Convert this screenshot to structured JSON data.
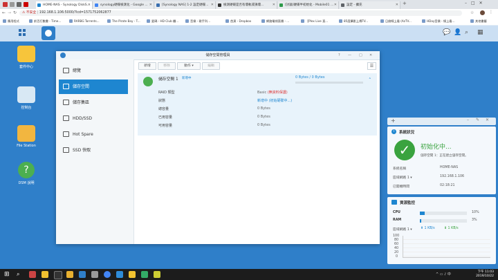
{
  "browser": {
    "tabs": [
      {
        "title": "HOME-NAS - Synology DiskS...",
        "active": true,
        "color": "#1e86d0"
      },
      {
        "title": "synology硬碟檢測化 - Google ...",
        "active": false,
        "color": "#4285f4"
      },
      {
        "title": "[Synology NAS] 1-2 設定硬碟...",
        "active": false,
        "color": "#3a6fb0"
      },
      {
        "title": "檢測硬碟是否有壞軌或損壞...",
        "active": false,
        "color": "#333333"
      },
      {
        "title": "[討論]硬碟半初始化 - Mobile01 ...",
        "active": false,
        "color": "#2e9a4a"
      },
      {
        "title": "設定 - 擴充",
        "active": false,
        "color": "#5f6368"
      }
    ],
    "new_tab": "+",
    "url_insecure": "不安全",
    "url": "192.168.1.106:5000/?lcd=1571752062877",
    "bookmarks": [
      "應用程式",
      "前百打數書 - Time...",
      "RARBG Torrents...",
      "The Pirate Bay - T...",
      "愛碼 - HD Club 櫃...",
      "音樂 - 歌手列... ",
      "首頁 - Dropbox",
      "網路電視直播 - ...",
      "【Plex Live 直...",
      "85度攝影上傳TV...",
      "日劇線上看 (AzTV...",
      "HDay音樂 - 線上看...",
      "其他書籤"
    ]
  },
  "desktop": {
    "icons": [
      {
        "label": "套件中心"
      },
      {
        "label": "控制台"
      },
      {
        "label": "File Station"
      },
      {
        "label": "DSM 說明"
      }
    ]
  },
  "window": {
    "title": "儲存空間管理員",
    "controls": [
      "?",
      "—",
      "□",
      "✕"
    ],
    "sidebar": [
      {
        "label": "總覽",
        "icon": "overview-icon",
        "selected": false
      },
      {
        "label": "儲存空間",
        "icon": "volume-icon",
        "selected": true
      },
      {
        "label": "儲存集區",
        "icon": "storage-pool-icon",
        "selected": false
      },
      {
        "label": "HDD/SSD",
        "icon": "hdd-icon",
        "selected": false
      },
      {
        "label": "Hot Spare",
        "icon": "hot-spare-icon",
        "selected": false
      },
      {
        "label": "SSD 快取",
        "icon": "ssd-cache-icon",
        "selected": false
      }
    ],
    "toolbar": {
      "create": "新增",
      "remove": "移除",
      "action": "動作 ▾",
      "edit": "編輯"
    },
    "volume": {
      "name": "儲存空間 1",
      "status_short": "新增中",
      "capacity": "0 Bytes / 0 Bytes",
      "progress": 0,
      "fields": [
        {
          "label": "RAID 類型",
          "value": "Basic",
          "extra": "(無資料保護)"
        },
        {
          "label": "狀態",
          "value": "新增中 (初始硬碟中...)",
          "extra": ""
        },
        {
          "label": "總容量",
          "value": "0 Bytes",
          "extra": ""
        },
        {
          "label": "已用容量",
          "value": "0 Bytes",
          "extra": ""
        },
        {
          "label": "可用容量",
          "value": "0 Bytes",
          "extra": ""
        }
      ]
    }
  },
  "widgets": {
    "system": {
      "title": "系統狀況",
      "status": "初始化中...",
      "message": "儲存空間 1：正在建立儲存空間。",
      "rows": [
        {
          "label": "系統名稱",
          "value": "HOME-NAS"
        },
        {
          "label": "區域網路 1 ▾",
          "value": "192.168.1.106"
        },
        {
          "label": "已開機時間",
          "value": "02:18:21"
        }
      ]
    },
    "resource": {
      "title": "資源監控",
      "cpu_label": "CPU",
      "cpu_value": "10%",
      "cpu_pct": 10,
      "ram_label": "RAM",
      "ram_value": "3%",
      "ram_pct": 3,
      "lan_label": "區域網路 1 ▾",
      "lan_up": "1 KB/s",
      "lan_down": "1 KB/s",
      "graph_ticks": [
        "100",
        "80",
        "60",
        "40",
        "20",
        "0"
      ]
    }
  },
  "taskbar": {
    "time": "下午 11:03",
    "date": "2019/10/22"
  }
}
